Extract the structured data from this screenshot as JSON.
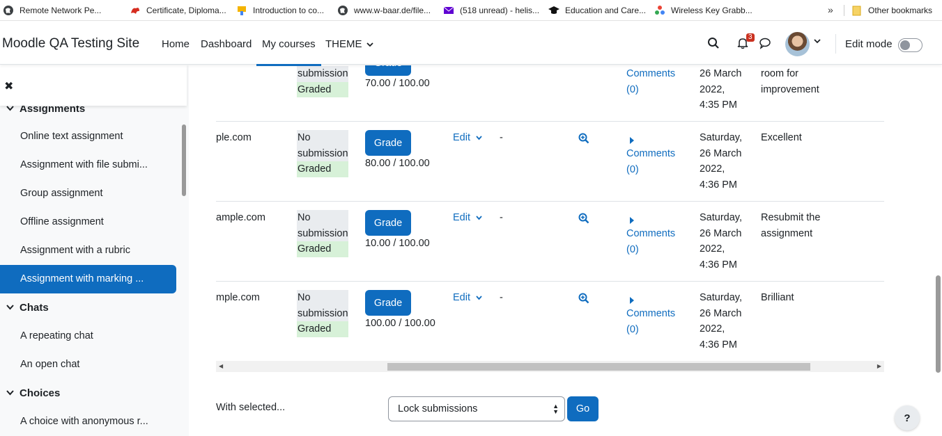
{
  "bookmarks": {
    "items": [
      {
        "label": "Remote Network Pe...",
        "icon": "globe-icon"
      },
      {
        "label": "Certificate, Diploma...",
        "icon": "dragon-icon"
      },
      {
        "label": "Introduction to co...",
        "icon": "paint-icon"
      },
      {
        "label": "www.w-baar.de/file...",
        "icon": "globe-icon"
      },
      {
        "label": "(518 unread) - helis...",
        "icon": "mail-icon"
      },
      {
        "label": "Education and Care...",
        "icon": "graduation-cap-icon"
      },
      {
        "label": "Wireless Key Grabb...",
        "icon": "dots-icon"
      }
    ],
    "more": "»",
    "other": "Other bookmarks"
  },
  "navbar": {
    "site_name": "Moodle QA Testing Site",
    "links": [
      "Home",
      "Dashboard",
      "My courses",
      "THEME"
    ],
    "notification_count": "3",
    "edit_mode_label": "Edit mode"
  },
  "drawer": {
    "close_symbol": "✖",
    "sections": [
      {
        "label": "Assignments",
        "chevron": "⌄"
      },
      {
        "label": "Chats",
        "chevron": "⌄"
      },
      {
        "label": "Choices",
        "chevron": "⌄"
      }
    ],
    "items": [
      "Online text assignment",
      "Assignment with file submi...",
      "Group assignment",
      "Offline assignment",
      "Assignment with a rubric",
      "Assignment with marking ...",
      "A repeating chat",
      "An open chat",
      "A choice with anonymous r..."
    ]
  },
  "table": {
    "rows": [
      {
        "email": "",
        "status_no": "submission",
        "status_graded": "Graded",
        "grade_label": "Grade",
        "grade_value": "70.00 / 100.00",
        "edit": "",
        "feedback_dash": "",
        "comments_label": "Comments",
        "comments_count": "(0)",
        "date_lines": [
          "26 March",
          "2022,",
          "4:35 PM"
        ],
        "feedback": [
          "room for",
          "improvement"
        ]
      },
      {
        "email": "ple.com",
        "status_no": "No submission",
        "status_graded": "Graded",
        "grade_label": "Grade",
        "grade_value": "80.00 / 100.00",
        "edit": "Edit",
        "feedback_dash": "-",
        "comments_label": "Comments",
        "comments_count": "(0)",
        "date_lines": [
          "Saturday,",
          "26 March",
          "2022,",
          "4:36 PM"
        ],
        "feedback": [
          "Excellent"
        ]
      },
      {
        "email": "ample.com",
        "status_no": "No submission",
        "status_graded": "Graded",
        "grade_label": "Grade",
        "grade_value": "10.00 / 100.00",
        "edit": "Edit",
        "feedback_dash": "-",
        "comments_label": "Comments",
        "comments_count": "(0)",
        "date_lines": [
          "Saturday,",
          "26 March",
          "2022,",
          "4:36 PM"
        ],
        "feedback": [
          "Resubmit the",
          "assignment"
        ]
      },
      {
        "email": "mple.com",
        "status_no": "No submission",
        "status_graded": "Graded",
        "grade_label": "Grade",
        "grade_value": "100.00 / 100.00",
        "edit": "Edit",
        "feedback_dash": "-",
        "comments_label": "Comments",
        "comments_count": "(0)",
        "date_lines": [
          "Saturday,",
          "26 March",
          "2022,",
          "4:36 PM"
        ],
        "feedback": [
          "Brilliant"
        ]
      }
    ]
  },
  "bulk": {
    "with_selected": "With selected...",
    "select_value": "Lock submissions",
    "go_label": "Go"
  },
  "help_label": "?",
  "colors": {
    "primary": "#0f6cbf",
    "graded_bg": "#d7f1d8",
    "nosub_bg": "#e9ecef",
    "badge": "#ca3120"
  }
}
